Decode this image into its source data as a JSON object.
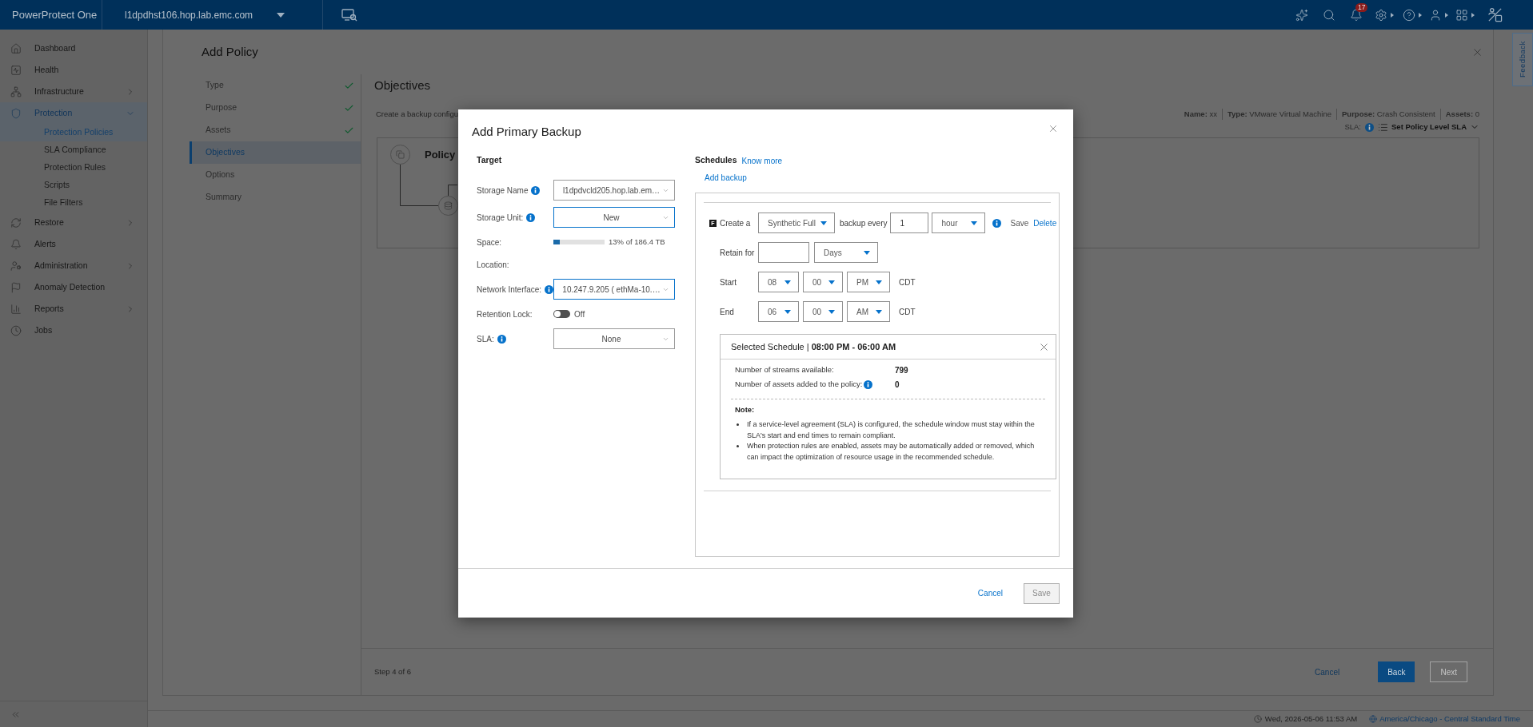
{
  "top_bar": {
    "brand": "PowerProtect One",
    "host": "l1dpdhst106.hop.lab.emc.com",
    "notifications": "17"
  },
  "sidebar": {
    "items": [
      {
        "label": "Dashboard",
        "selected": false
      },
      {
        "label": "Health",
        "selected": false
      },
      {
        "label": "Infrastructure",
        "selected": false,
        "expanded": false
      },
      {
        "label": "Protection",
        "selected": true,
        "expanded": true,
        "children": [
          {
            "label": "Protection Policies",
            "selected": true
          },
          {
            "label": "SLA Compliance",
            "selected": false
          },
          {
            "label": "Protection Rules",
            "selected": false
          },
          {
            "label": "Scripts",
            "selected": false
          },
          {
            "label": "File Filters",
            "selected": false
          }
        ]
      },
      {
        "label": "Restore",
        "selected": false,
        "expanded": false
      },
      {
        "label": "Alerts",
        "selected": false
      },
      {
        "label": "Administration",
        "selected": false,
        "expanded": false
      },
      {
        "label": "Anomaly Detection",
        "selected": false
      },
      {
        "label": "Reports",
        "selected": false,
        "expanded": false
      },
      {
        "label": "Jobs",
        "selected": false
      }
    ]
  },
  "page": {
    "title": "Add Policy",
    "steps": [
      {
        "label": "Type",
        "completed": true,
        "selected": false
      },
      {
        "label": "Purpose",
        "completed": true,
        "selected": false
      },
      {
        "label": "Assets",
        "completed": true,
        "selected": false
      },
      {
        "label": "Objectives",
        "completed": false,
        "selected": true
      },
      {
        "label": "Options",
        "completed": false,
        "selected": false
      },
      {
        "label": "Summary",
        "completed": false,
        "selected": false
      }
    ],
    "section_title": "Objectives",
    "description": "Create a backup configu",
    "summary": [
      "**Name:** xx",
      "**Type:** VMware Virtual Machine",
      "**Purpose:** Crash Consistent",
      "**Assets:** 0"
    ],
    "sla": {
      "label": "SLA:",
      "action": "Set Policy Level SLA"
    },
    "diagram": {
      "title": "Policy"
    },
    "footer": {
      "step": "Step 4 of 6",
      "actions": [
        {
          "label": "Cancel",
          "kind": "link"
        },
        {
          "label": "Back",
          "kind": "primary",
          "disabled": false
        },
        {
          "label": "Next",
          "kind": "primary",
          "disabled": true
        }
      ]
    }
  },
  "feedback_tab": {
    "label": "Feedback"
  },
  "dialog": {
    "title": "Add Primary Backup",
    "target": {
      "heading": "Target",
      "fields": [
        {
          "kind": "select",
          "label": "Storage Name",
          "info": true,
          "value": "l1dpdvcld205.hop.lab.em…",
          "focused": false
        },
        {
          "kind": "select",
          "label": "Storage Unit:",
          "info": true,
          "value": "New",
          "focused": true
        },
        {
          "kind": "meter",
          "label": "Space:",
          "level": 0.13,
          "reading": "13% of 186.4 TB"
        },
        {
          "kind": "text",
          "label": "Location:"
        },
        {
          "kind": "select",
          "label": "Network Interface:",
          "info": true,
          "value": "10.247.9.205 ( ethMa-10.…",
          "focused": true
        },
        {
          "kind": "toggle",
          "label": "Retention Lock:",
          "on": false,
          "reading": "Off"
        },
        {
          "kind": "select",
          "label": "SLA:",
          "info": true,
          "value": "None",
          "focused": false
        }
      ]
    },
    "schedules": {
      "heading": "Schedules",
      "link": "Know more",
      "add": "Add backup",
      "backup": {
        "badge": "F",
        "create_label": "Create a",
        "type": "Synthetic Full",
        "every_label": "backup every",
        "every_value": "1",
        "unit": "hour",
        "info": true,
        "actions": [
          {
            "label": "Save",
            "kind": "plain"
          },
          {
            "label": "Delete",
            "kind": "link"
          }
        ],
        "retain_label": "Retain for",
        "retain_unit": "Days",
        "times": [
          {
            "label": "Start",
            "hour": "08",
            "minute": "00",
            "period": "PM",
            "zone": "CDT"
          },
          {
            "label": "End",
            "hour": "06",
            "minute": "00",
            "period": "AM",
            "zone": "CDT"
          }
        ]
      },
      "selected_schedule": {
        "title": "Selected Schedule | **08:00 PM - 06:00 AM**",
        "stats": [
          {
            "label": "Number of streams available:",
            "value": "799"
          },
          {
            "label": "Number of assets added to the policy:",
            "value": "0",
            "info": true
          }
        ],
        "note_title": "Note:",
        "notes": [
          "If a service-level agreement (SLA) is configured, the schedule window must stay within the SLA's start and end times to remain compliant.",
          "When protection rules are enabled, assets may be automatically added or removed, which can impact the optimization of resource usage in the recommended schedule."
        ]
      }
    },
    "actions": [
      {
        "label": "Cancel",
        "kind": "link"
      },
      {
        "label": "Save",
        "kind": "button",
        "disabled": true
      }
    ]
  },
  "status_bar": {
    "datetime": "Wed, 2026-05-06 11:53 AM",
    "timezone": "America/Chicago - Central Standard Time"
  }
}
